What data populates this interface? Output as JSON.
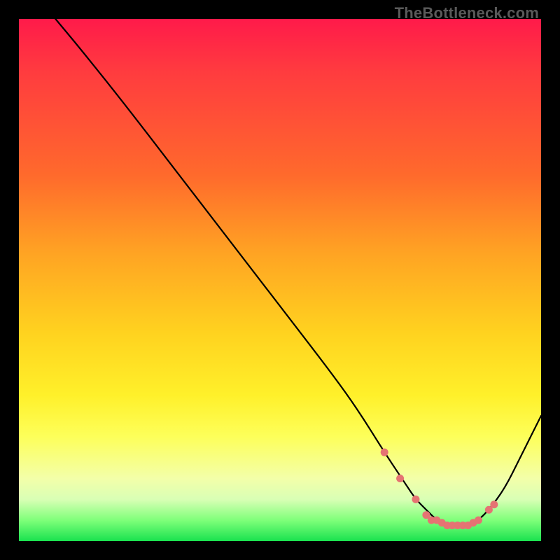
{
  "watermark": "TheBottleneck.com",
  "chart_data": {
    "type": "line",
    "title": "",
    "xlabel": "",
    "ylabel": "",
    "xlim": [
      0,
      100
    ],
    "ylim": [
      0,
      100
    ],
    "grid": false,
    "legend": false,
    "series": [
      {
        "name": "curve",
        "x": [
          7,
          12,
          20,
          30,
          40,
          50,
          60,
          65,
          70,
          74,
          76,
          78,
          80,
          82,
          84,
          86,
          88,
          90,
          93,
          96,
          100
        ],
        "y": [
          100,
          94,
          84,
          71,
          58,
          45,
          32,
          25,
          17,
          11,
          8,
          6,
          4,
          3,
          3,
          3,
          4,
          6,
          10,
          16,
          24
        ]
      }
    ],
    "markers": {
      "name": "highlight-dots",
      "x": [
        70,
        73,
        76,
        78,
        79,
        80,
        81,
        82,
        83,
        84,
        85,
        86,
        87,
        88,
        90,
        91
      ],
      "y": [
        17,
        12,
        8,
        5,
        4,
        4,
        3.5,
        3,
        3,
        3,
        3,
        3,
        3.5,
        4,
        6,
        7
      ]
    }
  },
  "colors": {
    "curve": "#000000",
    "dots": "#e57373",
    "gradient_top": "#ff1a4a",
    "gradient_bottom": "#19e24f"
  }
}
